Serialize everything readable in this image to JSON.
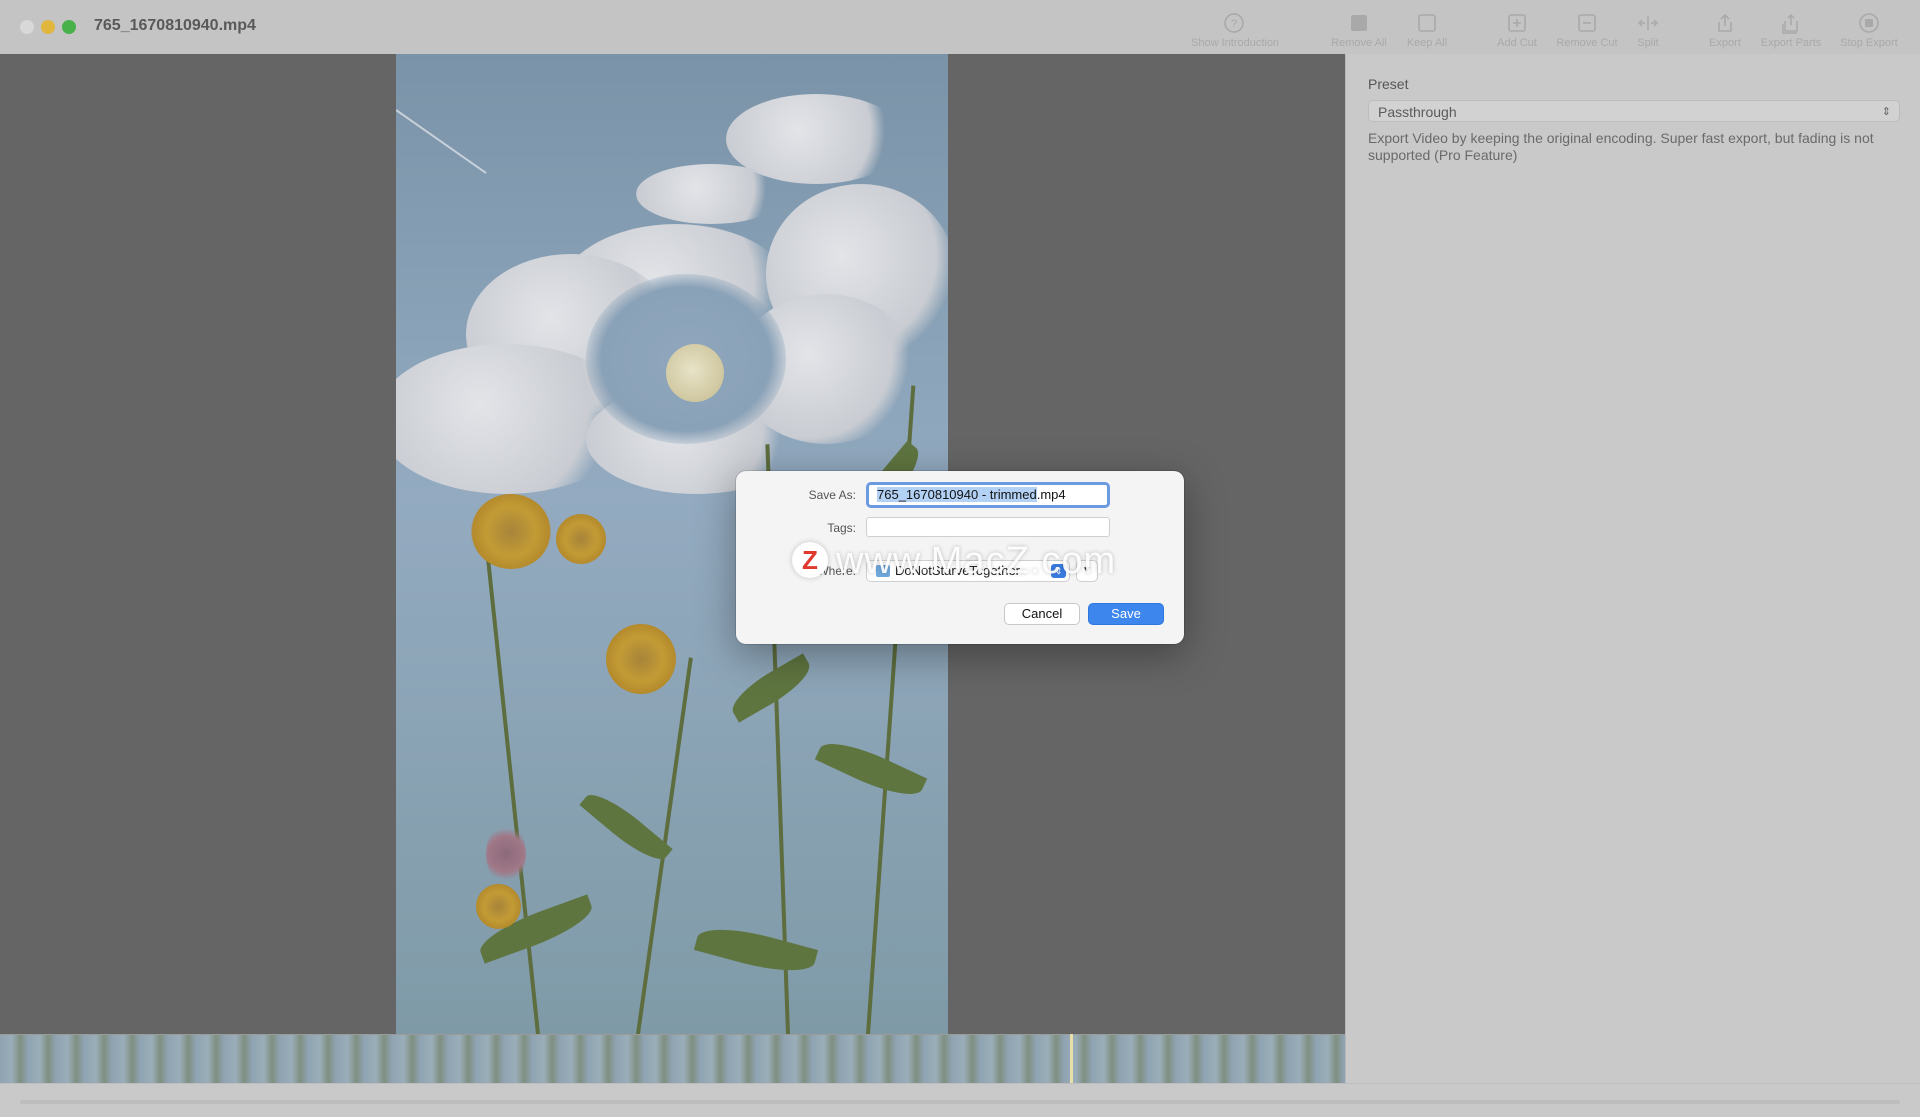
{
  "window": {
    "title": "765_1670810940.mp4"
  },
  "toolbar": {
    "items": [
      {
        "label": "Show Introduction",
        "icon": "question-circle-icon"
      },
      {
        "label": "Remove All",
        "icon": "filled-square-icon"
      },
      {
        "label": "Keep All",
        "icon": "empty-square-icon"
      },
      {
        "label": "Add Cut",
        "icon": "plus-square-icon"
      },
      {
        "label": "Remove Cut",
        "icon": "minus-square-icon"
      },
      {
        "label": "Split",
        "icon": "split-arrows-icon"
      },
      {
        "label": "Export",
        "icon": "share-icon"
      },
      {
        "label": "Export Parts",
        "icon": "share-multiple-icon"
      },
      {
        "label": "Stop Export",
        "icon": "stop-circle-icon"
      }
    ]
  },
  "side_panel": {
    "preset_label": "Preset",
    "preset_value": "Passthrough",
    "preset_description": "Export Video by keeping the original encoding. Super fast export, but fading is not supported (Pro Feature)"
  },
  "save_dialog": {
    "save_as_label": "Save As:",
    "filename_selected": "765_1670810940 - trimmed",
    "filename_ext": ".mp4",
    "tags_label": "Tags:",
    "where_label": "Where:",
    "where_value": "DoNotStarveTogether",
    "cancel_label": "Cancel",
    "save_label": "Save"
  },
  "watermark": {
    "logo_letter": "Z",
    "text": "www.MacZ.com"
  },
  "colors": {
    "accent": "#3d86ed",
    "preview_bg": "#656565"
  }
}
